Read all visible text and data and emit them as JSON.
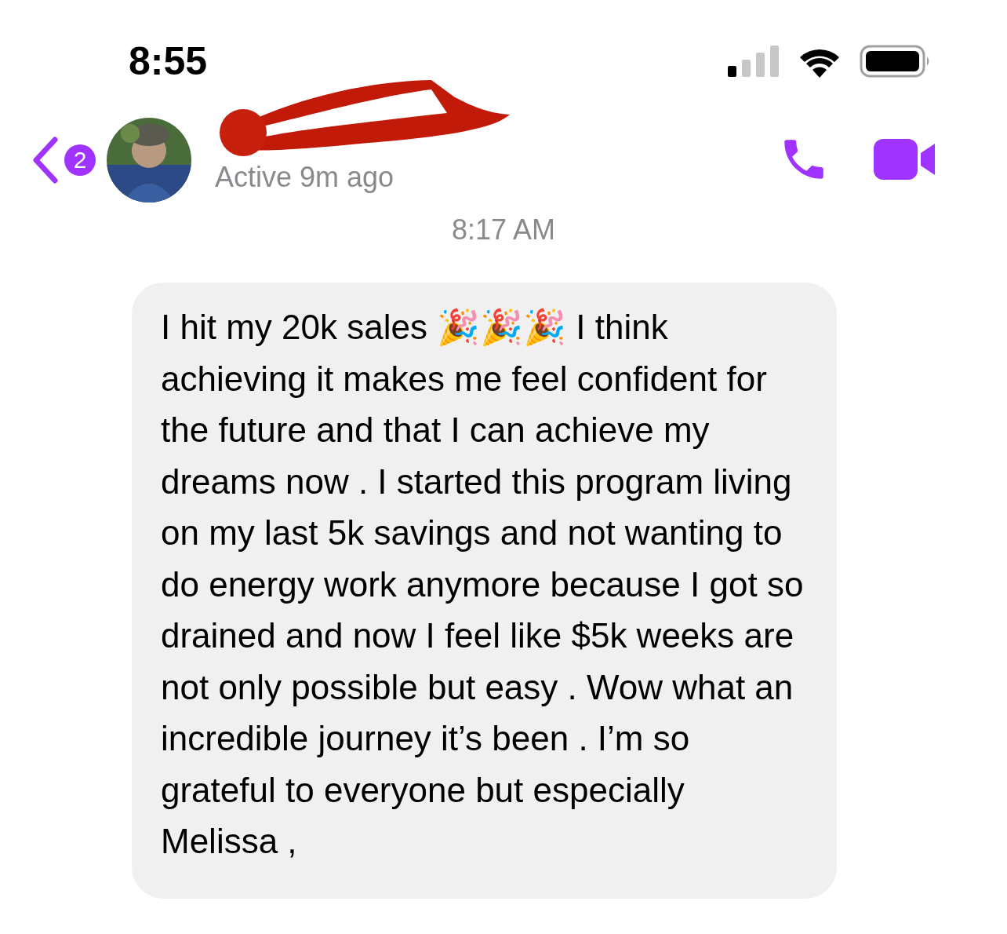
{
  "status_bar": {
    "time": "8:55"
  },
  "header": {
    "unread_count": "2",
    "status": "Active 9m ago"
  },
  "timestamp": "8:17 AM",
  "messages": [
    {
      "text": "I hit my 20k sales 🎉🎉🎉 I think achieving it makes me feel confident for the future and that I can achieve my dreams now . I started this program living on my last 5k savings and not wanting to do energy work anymore because I got so drained and now I feel like $5k weeks are not only possible but easy . Wow what an incredible journey it’s been . I’m so grateful to everyone but especially Melissa ,"
    }
  ]
}
